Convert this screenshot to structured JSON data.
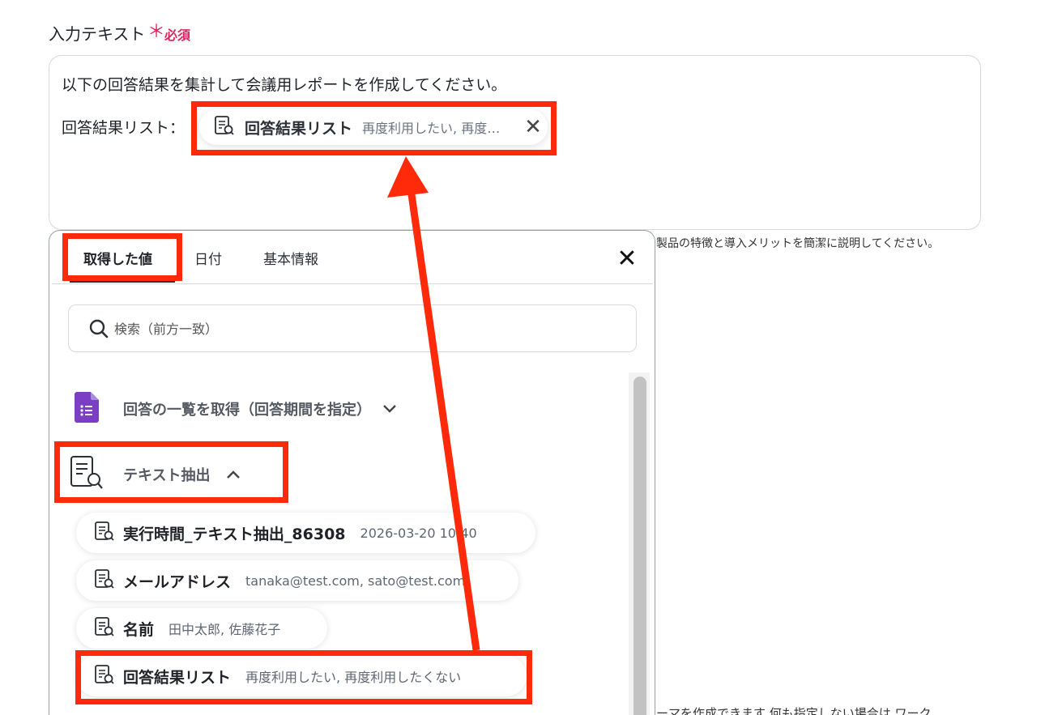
{
  "field": {
    "label": "入力テキスト",
    "required_star": "＊",
    "required_text": "必須"
  },
  "textarea": {
    "line1": "以下の回答結果を集計して会議用レポートを作成してください。",
    "line2_prefix": "回答結果リスト："
  },
  "inserted_chip": {
    "title": "回答結果リスト",
    "preview": "再度利用したい, 再度利用したくない",
    "close_glyph": "✕"
  },
  "hints": {
    "top": "製品の特徴と導入メリットを簡潔に説明してください。",
    "bottom": "ーマを作成できます 何も指定しない場合は ワーク"
  },
  "panel": {
    "tabs": [
      {
        "label": "取得した値",
        "active": true
      },
      {
        "label": "日付",
        "active": false
      },
      {
        "label": "基本情報",
        "active": false
      }
    ],
    "close_glyph": "✕",
    "search_placeholder": "検索（前方一致）",
    "groups": [
      {
        "title": "回答の一覧を取得（回答期間を指定）",
        "expanded": false,
        "icon": "google-forms-icon"
      },
      {
        "title": "テキスト抽出",
        "expanded": true,
        "icon": "text-extract-icon"
      }
    ],
    "items": [
      {
        "title": "実行時間_テキスト抽出_86308",
        "value": "2026-03-20 10:40"
      },
      {
        "title": "メールアドレス",
        "value": "tanaka@test.com, sato@test.com"
      },
      {
        "title": "名前",
        "value": "田中太郎, 佐藤花子"
      },
      {
        "title": "回答結果リスト",
        "value": "再度利用したい, 再度利用したくない"
      }
    ]
  },
  "colors": {
    "highlight": "#ff2a0a",
    "required": "#e0245e",
    "forms_purple": "#7b3fc4"
  }
}
